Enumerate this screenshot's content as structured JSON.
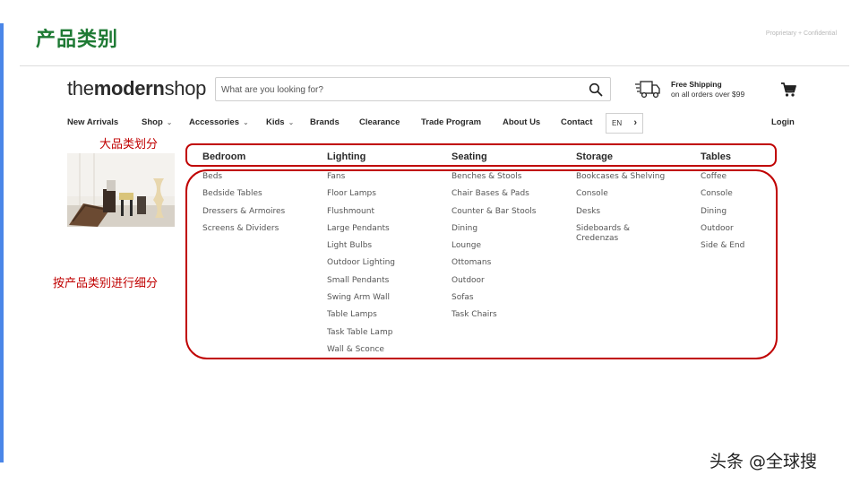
{
  "slide": {
    "title": "产品类别",
    "confidential": "Proprietary + Confidential",
    "annotation_top": "大品类划分",
    "annotation_side": "按产品类别进行细分",
    "watermark": "头条 @全球搜"
  },
  "header": {
    "logo_pre": "the",
    "logo_bold": "modern",
    "logo_post": "shop",
    "search_placeholder": "What are you looking for?",
    "shipping_title": "Free Shipping",
    "shipping_sub": "on all orders over $99"
  },
  "nav": {
    "items": [
      {
        "label": "New Arrivals"
      },
      {
        "label": "Shop",
        "chevron": "⌄"
      },
      {
        "label": "Accessories",
        "chevron": "⌄"
      },
      {
        "label": "Kids",
        "chevron": "⌄"
      },
      {
        "label": "Brands"
      },
      {
        "label": "Clearance"
      },
      {
        "label": "Trade Program"
      },
      {
        "label": "About Us"
      },
      {
        "label": "Contact"
      }
    ],
    "language": "EN",
    "language_arrow": "›",
    "login": "Login"
  },
  "menu": {
    "columns": [
      {
        "title": "Bedroom",
        "items": [
          "Beds",
          "Bedside Tables",
          "Dressers & Armoires",
          "Screens & Dividers"
        ]
      },
      {
        "title": "Lighting",
        "items": [
          "Fans",
          "Floor Lamps",
          "Flushmount",
          "Large Pendants",
          "Light Bulbs",
          "Outdoor Lighting",
          "Small Pendants",
          "Swing Arm Wall",
          "Table Lamps",
          "Task Table Lamp",
          "Wall & Sconce"
        ]
      },
      {
        "title": "Seating",
        "items": [
          "Benches & Stools",
          "Chair Bases & Pads",
          "Counter & Bar Stools",
          "Dining",
          "Lounge",
          "Ottomans",
          "Outdoor",
          "Sofas",
          "Task Chairs"
        ]
      },
      {
        "title": "Storage",
        "items": [
          "Bookcases & Shelving",
          "Console",
          "Desks",
          "Sideboards & Credenzas"
        ]
      },
      {
        "title": "Tables",
        "items": [
          "Coffee",
          "Console",
          "Dining",
          "Outdoor",
          "Side & End"
        ]
      }
    ]
  },
  "colors": {
    "title_green": "#1e7a34",
    "annotation_red": "#c00000",
    "accent_blue": "#4a86e8"
  }
}
